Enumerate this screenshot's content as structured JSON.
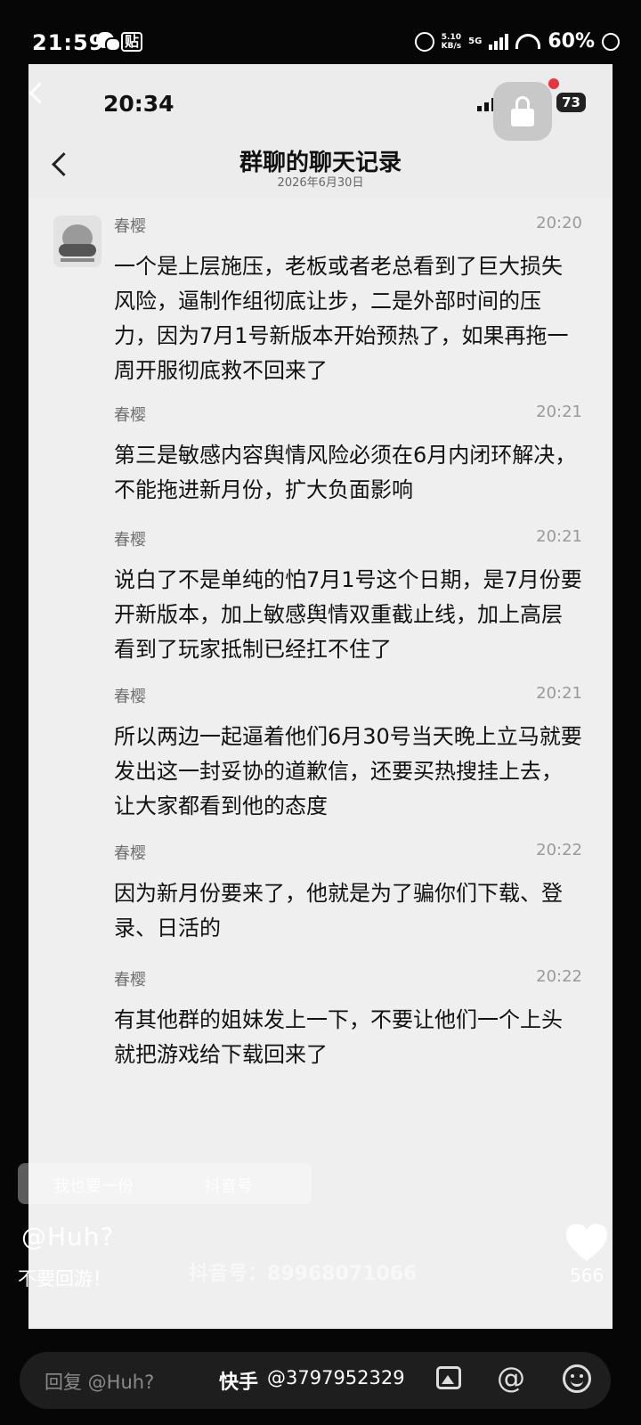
{
  "status_bar": {
    "time": "21:59",
    "app_badge": "贴",
    "net_speed_top": "5.10",
    "net_speed_bottom": "KB/s",
    "network": "5G",
    "battery": "60%"
  },
  "inner_status": {
    "time": "20:34",
    "battery": "73"
  },
  "header": {
    "title": "群聊的聊天记录",
    "date": "2026年6月30日"
  },
  "messages": [
    {
      "sender": "春樱",
      "time": "20:20",
      "text": "一个是上层施压，老板或者老总看到了巨大损失风险，逼制作组彻底让步，二是外部时间的压力，因为7月1号新版本开始预热了，如果再拖一周开服彻底救不回来了"
    },
    {
      "sender": "春樱",
      "time": "20:21",
      "text": "第三是敏感内容舆情风险必须在6月内闭环解决，不能拖进新月份，扩大负面影响"
    },
    {
      "sender": "春樱",
      "time": "20:21",
      "text": "说白了不是单纯的怕7月1号这个日期，是7月份要开新版本，加上敏感舆情双重截止线，加上高层看到了玩家抵制已经扛不住了"
    },
    {
      "sender": "春樱",
      "time": "20:21",
      "text": "所以两边一起逼着他们6月30号当天晚上立马就要发出这一封妥协的道歉信，还要买热搜挂上去，让大家都看到他的态度"
    },
    {
      "sender": "春樱",
      "time": "20:22",
      "text": "因为新月份要来了，他就是为了骗你们下载、登录、日活的"
    },
    {
      "sender": "春樱",
      "time": "20:22",
      "text": "有其他群的姐妹发上一下，不要让他们一个上头就把游戏给下载回来了"
    }
  ],
  "overlay": {
    "ghost_left": "我也要一份",
    "ghost_right": "抖音号",
    "handle": "@Huh?",
    "caption": "不要回游！",
    "watermark": "抖音号：89968071066",
    "likes": "566"
  },
  "bottom_bar": {
    "reply_placeholder": "回复 @Huh?",
    "brand": "快手",
    "user_id": "@3797952329"
  }
}
